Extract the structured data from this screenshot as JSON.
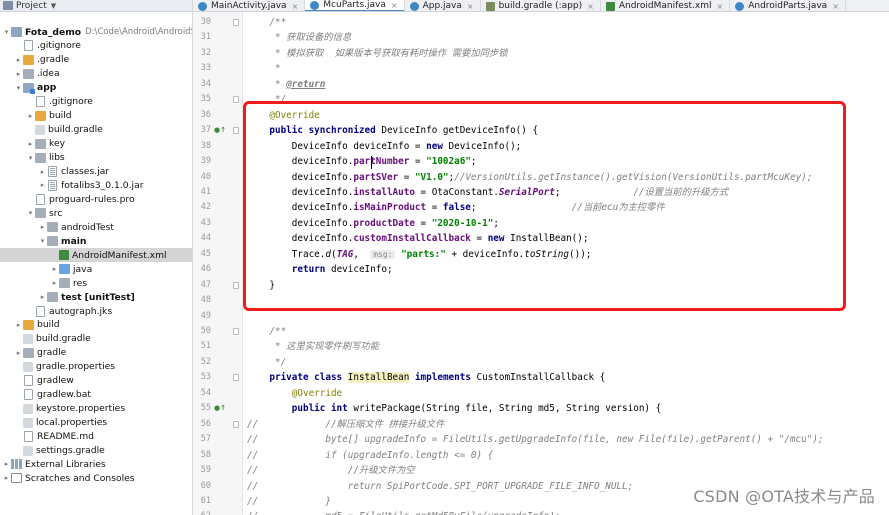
{
  "project_panel": {
    "title": "Project",
    "tree": [
      {
        "label": "Fota_demo",
        "path": "D:\\Code\\Android\\AndroidSt",
        "icon": "folder",
        "arrow": "down",
        "indent": 0,
        "bold": true
      },
      {
        "label": ".gitignore",
        "icon": "file",
        "arrow": "none",
        "indent": 1
      },
      {
        "label": ".gradle",
        "icon": "folder-orange",
        "arrow": "right",
        "indent": 1
      },
      {
        "label": ".idea",
        "icon": "folder-gray",
        "arrow": "right",
        "indent": 1
      },
      {
        "label": "app",
        "icon": "module",
        "arrow": "down",
        "indent": 1,
        "bold": true
      },
      {
        "label": ".gitignore",
        "icon": "file",
        "arrow": "none",
        "indent": 2
      },
      {
        "label": "build",
        "icon": "folder-orange",
        "arrow": "right",
        "indent": 2
      },
      {
        "label": "build.gradle",
        "icon": "file-bars",
        "arrow": "none",
        "indent": 2
      },
      {
        "label": "key",
        "icon": "folder-gray",
        "arrow": "right",
        "indent": 2
      },
      {
        "label": "libs",
        "icon": "folder-gray",
        "arrow": "down",
        "indent": 2
      },
      {
        "label": "classes.jar",
        "icon": "file-jar",
        "arrow": "right",
        "indent": 3
      },
      {
        "label": "fotalibs3_0.1.0.jar",
        "icon": "file-jar",
        "arrow": "right",
        "indent": 3
      },
      {
        "label": "proguard-rules.pro",
        "icon": "file",
        "arrow": "none",
        "indent": 2
      },
      {
        "label": "src",
        "icon": "folder-gray",
        "arrow": "down",
        "indent": 2
      },
      {
        "label": "androidTest",
        "icon": "folder-gray",
        "arrow": "right",
        "indent": 3
      },
      {
        "label": "main",
        "icon": "folder-gray",
        "arrow": "down",
        "indent": 3,
        "bold": true
      },
      {
        "label": "AndroidManifest.xml",
        "icon": "file-xml",
        "arrow": "none",
        "indent": 4,
        "selected": true
      },
      {
        "label": "java",
        "icon": "folder-blue",
        "arrow": "right",
        "indent": 4
      },
      {
        "label": "res",
        "icon": "folder-gray",
        "arrow": "right",
        "indent": 4
      },
      {
        "label": "test [unitTest]",
        "icon": "folder-gray",
        "arrow": "right",
        "indent": 3,
        "bold": true
      },
      {
        "label": "autograph.jks",
        "icon": "file",
        "arrow": "none",
        "indent": 2
      },
      {
        "label": "build",
        "icon": "folder-orange",
        "arrow": "right",
        "indent": 1
      },
      {
        "label": "build.gradle",
        "icon": "file-bars",
        "arrow": "none",
        "indent": 1
      },
      {
        "label": "gradle",
        "icon": "folder-gray",
        "arrow": "right",
        "indent": 1
      },
      {
        "label": "gradle.properties",
        "icon": "file-bars",
        "arrow": "none",
        "indent": 1
      },
      {
        "label": "gradlew",
        "icon": "file",
        "arrow": "none",
        "indent": 1
      },
      {
        "label": "gradlew.bat",
        "icon": "file",
        "arrow": "none",
        "indent": 1
      },
      {
        "label": "keystore.properties",
        "icon": "file-bars",
        "arrow": "none",
        "indent": 1
      },
      {
        "label": "local.properties",
        "icon": "file-bars",
        "arrow": "none",
        "indent": 1
      },
      {
        "label": "README.md",
        "icon": "file",
        "arrow": "none",
        "indent": 1
      },
      {
        "label": "settings.gradle",
        "icon": "file-bars",
        "arrow": "none",
        "indent": 1
      },
      {
        "label": "External Libraries",
        "icon": "lib",
        "arrow": "right",
        "indent": 0
      },
      {
        "label": "Scratches and Consoles",
        "icon": "console",
        "arrow": "right",
        "indent": 0
      }
    ]
  },
  "editor": {
    "tabs": [
      {
        "label": "MainActivity.java",
        "icon": "java",
        "active": false
      },
      {
        "label": "McuParts.java",
        "icon": "java",
        "active": true
      },
      {
        "label": "App.java",
        "icon": "java",
        "active": false
      },
      {
        "label": "build.gradle (:app)",
        "icon": "gradle",
        "active": false
      },
      {
        "label": "AndroidManifest.xml",
        "icon": "xml",
        "active": false
      },
      {
        "label": "AndroidParts.java",
        "icon": "java",
        "active": false
      }
    ],
    "line_numbers": [
      "30",
      "31",
      "32",
      "33",
      "34",
      "35",
      "36",
      "37",
      "38",
      "39",
      "40",
      "41",
      "42",
      "43",
      "44",
      "45",
      "46",
      "47",
      "48",
      "49",
      "50",
      "51",
      "52",
      "53",
      "54",
      "55",
      "56",
      "57",
      "58",
      "59",
      "60",
      "61",
      "62"
    ],
    "override_marker_lines": [
      "37",
      "55"
    ],
    "fold_marker_lines": [
      "30",
      "35",
      "37",
      "47",
      "50",
      "53",
      "56"
    ],
    "code_lines": [
      [
        {
          "t": "    /**",
          "c": "cmt"
        }
      ],
      [
        {
          "t": "     * 获取设备的信息",
          "c": "cmt"
        }
      ],
      [
        {
          "t": "     * 模拟获取  如果版本号获取有耗时操作 需要加同步锁",
          "c": "cmt"
        }
      ],
      [
        {
          "t": "     *",
          "c": "cmt"
        }
      ],
      [
        {
          "t": "     * ",
          "c": "cmt"
        },
        {
          "t": "@return",
          "c": "doctag"
        }
      ],
      [
        {
          "t": "     */",
          "c": "cmt"
        }
      ],
      [
        {
          "t": "    ",
          "c": ""
        },
        {
          "t": "@Override",
          "c": "ann"
        }
      ],
      [
        {
          "t": "    ",
          "c": ""
        },
        {
          "t": "public synchronized ",
          "c": "kw"
        },
        {
          "t": "DeviceInfo getDeviceInfo() {",
          "c": ""
        }
      ],
      [
        {
          "t": "        DeviceInfo deviceInfo = ",
          "c": ""
        },
        {
          "t": "new ",
          "c": "kw"
        },
        {
          "t": "DeviceInfo();",
          "c": ""
        }
      ],
      [
        {
          "t": "        deviceInfo.",
          "c": ""
        },
        {
          "t": "partNumber",
          "c": "fld"
        },
        {
          "t": " = ",
          "c": ""
        },
        {
          "t": "\"1002a6\"",
          "c": "str"
        },
        {
          "t": ";",
          "c": ""
        }
      ],
      [
        {
          "t": "        deviceInfo.",
          "c": ""
        },
        {
          "t": "partSVer",
          "c": "fld"
        },
        {
          "t": " = ",
          "c": ""
        },
        {
          "t": "\"V1.0\"",
          "c": "str"
        },
        {
          "t": ";",
          "c": ""
        },
        {
          "t": "//VersionUtils.getInstance().getVision(VersionUtils.partMcuKey);",
          "c": "cmt"
        }
      ],
      [
        {
          "t": "        deviceInfo.",
          "c": ""
        },
        {
          "t": "installAuto",
          "c": "fld"
        },
        {
          "t": " = OtaConstant.",
          "c": ""
        },
        {
          "t": "SerialPort",
          "c": "static-it"
        },
        {
          "t": ";             ",
          "c": ""
        },
        {
          "t": "//设置当前的升级方式",
          "c": "cmt"
        }
      ],
      [
        {
          "t": "        deviceInfo.",
          "c": ""
        },
        {
          "t": "isMainProduct",
          "c": "fld"
        },
        {
          "t": " = ",
          "c": ""
        },
        {
          "t": "false",
          "c": "kw"
        },
        {
          "t": ";                 ",
          "c": ""
        },
        {
          "t": "//当前ecu为主控零件",
          "c": "cmt"
        }
      ],
      [
        {
          "t": "        deviceInfo.",
          "c": ""
        },
        {
          "t": "productDate",
          "c": "fld"
        },
        {
          "t": " = ",
          "c": ""
        },
        {
          "t": "\"2020-10-1\"",
          "c": "str"
        },
        {
          "t": ";",
          "c": ""
        }
      ],
      [
        {
          "t": "        deviceInfo.",
          "c": ""
        },
        {
          "t": "customInstallCallback",
          "c": "fld"
        },
        {
          "t": " = ",
          "c": ""
        },
        {
          "t": "new ",
          "c": "kw"
        },
        {
          "t": "InstallBean();",
          "c": ""
        }
      ],
      [
        {
          "t": "        Trace.",
          "c": ""
        },
        {
          "t": "d",
          "c": "meth-it"
        },
        {
          "t": "(",
          "c": ""
        },
        {
          "t": "TAG",
          "c": "static-it"
        },
        {
          "t": ",  ",
          "c": ""
        },
        {
          "t": "msg:",
          "c": "hint"
        },
        {
          "t": " ",
          "c": ""
        },
        {
          "t": "\"parts:\"",
          "c": "str"
        },
        {
          "t": " + deviceInfo.",
          "c": ""
        },
        {
          "t": "toString",
          "c": "meth-it"
        },
        {
          "t": "());",
          "c": ""
        }
      ],
      [
        {
          "t": "        ",
          "c": ""
        },
        {
          "t": "return ",
          "c": "kw"
        },
        {
          "t": "deviceInfo;",
          "c": ""
        }
      ],
      [
        {
          "t": "    }",
          "c": ""
        }
      ],
      [
        {
          "t": "",
          "c": ""
        }
      ],
      [
        {
          "t": "",
          "c": ""
        }
      ],
      [
        {
          "t": "    /**",
          "c": "cmt"
        }
      ],
      [
        {
          "t": "     * 这里实现零件刷写功能",
          "c": "cmt"
        }
      ],
      [
        {
          "t": "     */",
          "c": "cmt"
        }
      ],
      [
        {
          "t": "    ",
          "c": ""
        },
        {
          "t": "private class ",
          "c": "kw"
        },
        {
          "t": "InstallBean",
          "c": "hl-class"
        },
        {
          "t": " ",
          "c": ""
        },
        {
          "t": "implements ",
          "c": "kw"
        },
        {
          "t": "CustomInstallCallback {",
          "c": ""
        }
      ],
      [
        {
          "t": "        ",
          "c": ""
        },
        {
          "t": "@Override",
          "c": "ann"
        }
      ],
      [
        {
          "t": "        ",
          "c": ""
        },
        {
          "t": "public int ",
          "c": "kw"
        },
        {
          "t": "writePackage(String file, String md5, String version) {",
          "c": ""
        }
      ],
      [
        {
          "t": "//            //解压缩文件 拼接升级文件",
          "c": "cmt"
        }
      ],
      [
        {
          "t": "//            byte[] upgradeInfo = FileUtils.getUpgradeInfo(file, new File(file).getParent() + \"/mcu\");",
          "c": "cmt"
        }
      ],
      [
        {
          "t": "//            if (upgradeInfo.length <= 0) {",
          "c": "cmt"
        }
      ],
      [
        {
          "t": "//                //升级文件为空",
          "c": "cmt"
        }
      ],
      [
        {
          "t": "//                return SpiPortCode.SPI_PORT_UPGRADE_FILE_INFO_NULL;",
          "c": "cmt"
        }
      ],
      [
        {
          "t": "//            }",
          "c": "cmt"
        }
      ],
      [
        {
          "t": "//            md5 = FileUtils.getMd5ByFile(upgradeInfo);",
          "c": "cmt"
        }
      ]
    ]
  },
  "watermark": "CSDN @OTA技术与产品",
  "colors": {
    "highlight_box": "#ee1c1c",
    "keyword": "#000080",
    "string": "#008000",
    "comment": "#808080",
    "field": "#660e7a",
    "annotation": "#808000"
  }
}
